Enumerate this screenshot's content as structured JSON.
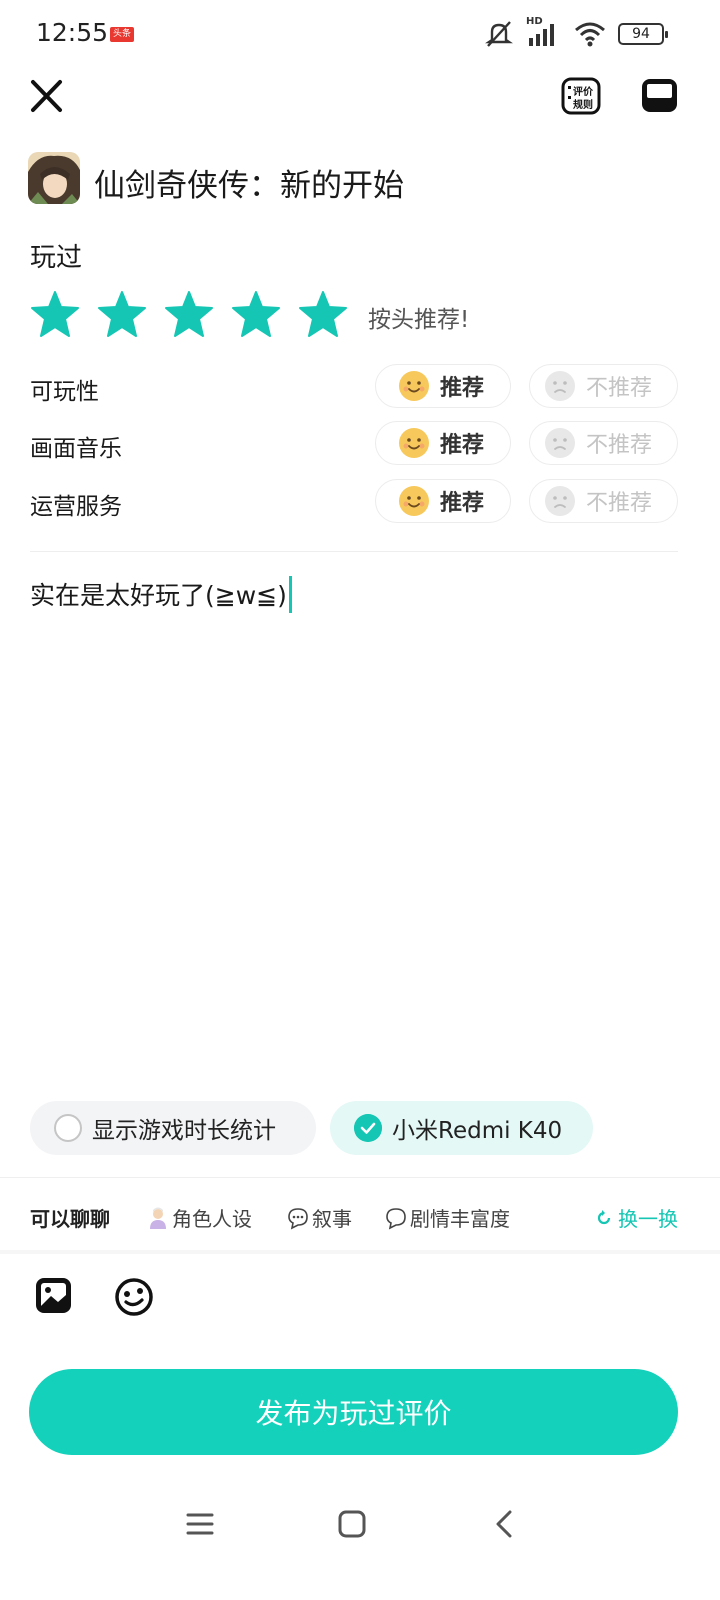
{
  "status_bar": {
    "time": "12:55",
    "notification_badge": "头条",
    "battery": "94",
    "network_label": "HD",
    "icons": [
      "mute-bell-icon",
      "signal-icon",
      "wifi-icon",
      "battery-icon"
    ]
  },
  "top_bar": {
    "close_icon": "close-icon",
    "rules_label_line1": "评价",
    "rules_label_line2": "规则",
    "draft_icon": "inbox-icon"
  },
  "game": {
    "title": "仙剑奇侠传：新的开始"
  },
  "status_label": "玩过",
  "stars": {
    "value": 5,
    "max": 5,
    "comment": "按头推荐!",
    "color": "#14c6b3"
  },
  "ratings": [
    {
      "label": "可玩性",
      "recommend": "推荐",
      "not_recommend": "不推荐",
      "selected": "recommend"
    },
    {
      "label": "画面音乐",
      "recommend": "推荐",
      "not_recommend": "不推荐",
      "selected": "recommend"
    },
    {
      "label": "运营服务",
      "recommend": "推荐",
      "not_recommend": "不推荐",
      "selected": "recommend"
    }
  ],
  "review": {
    "text": "实在是太好玩了(≧w≦)"
  },
  "options": {
    "playtime": {
      "label": "显示游戏时长统计",
      "checked": false
    },
    "device": {
      "label": "小米Redmi K40",
      "checked": true
    }
  },
  "topics": {
    "title": "可以聊聊",
    "items": [
      {
        "label": "角色人设",
        "icon": "person-emoji-icon"
      },
      {
        "label": "叙事",
        "icon": "speech-bubble-icon"
      },
      {
        "label": "剧情丰富度",
        "icon": "thought-bubble-icon"
      }
    ],
    "refresh": "换一换"
  },
  "toolbar": {
    "icons": [
      "image-icon",
      "emoji-icon"
    ]
  },
  "publish": {
    "label": "发布为玩过评价"
  },
  "colors": {
    "accent": "#14d1bb",
    "face_yellow": "#f7c95c",
    "disabled": "#c4c4c4"
  },
  "nav": {
    "icons": [
      "menu-icon",
      "home-icon",
      "back-icon"
    ]
  }
}
